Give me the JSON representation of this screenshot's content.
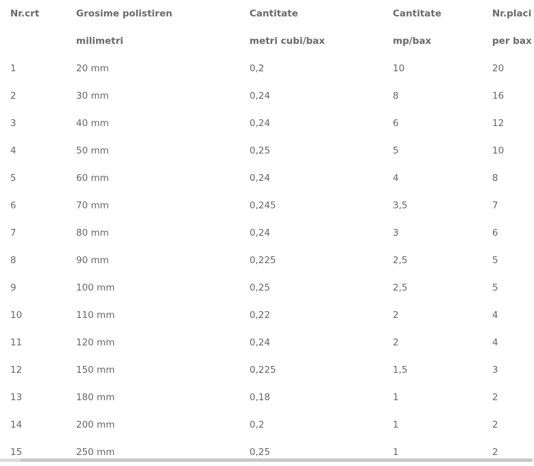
{
  "headers": {
    "row1": [
      "Nr.crt",
      "Grosime polistiren",
      "Cantitate",
      "Cantitate",
      "Nr.placi"
    ],
    "row2": [
      "",
      "milimetri",
      "metri cubi/bax",
      "mp/bax",
      "per bax"
    ]
  },
  "rows": [
    [
      "1",
      "20 mm",
      "0,2",
      "10",
      "20"
    ],
    [
      "2",
      "30 mm",
      "0,24",
      "8",
      "16"
    ],
    [
      "3",
      "40 mm",
      "0,24",
      "6",
      "12"
    ],
    [
      "4",
      "50 mm",
      "0,25",
      "5",
      "10"
    ],
    [
      "5",
      "60 mm",
      "0,24",
      "4",
      "8"
    ],
    [
      "6",
      "70 mm",
      "0,245",
      "3,5",
      "7"
    ],
    [
      "7",
      "80 mm",
      "0,24",
      "3",
      "6"
    ],
    [
      "8",
      "90 mm",
      "0,225",
      "2,5",
      "5"
    ],
    [
      "9",
      "100 mm",
      "0,25",
      "2,5",
      "5"
    ],
    [
      "10",
      "110 mm",
      "0,22",
      "2",
      "4"
    ],
    [
      "11",
      "120 mm",
      "0,24",
      "2",
      "4"
    ],
    [
      "12",
      "150 mm",
      "0,225",
      "1,5",
      "3"
    ],
    [
      "13",
      "180 mm",
      "0,18",
      "1",
      "2"
    ],
    [
      "14",
      "200 mm",
      "0,2",
      "1",
      "2"
    ],
    [
      "15",
      "250 mm",
      "0,25",
      "1",
      "2"
    ]
  ],
  "colors": {
    "text": "#666666",
    "header_text": "#6a6a6a",
    "background": "#ffffff"
  }
}
